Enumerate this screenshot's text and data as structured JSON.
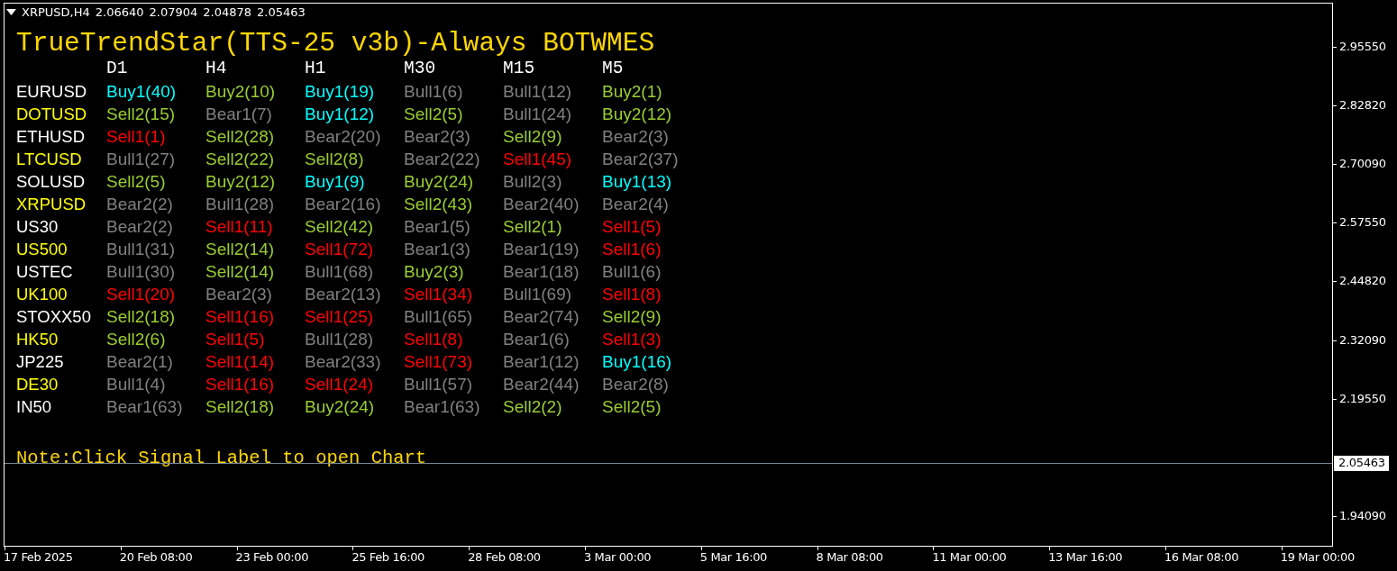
{
  "chart_header": {
    "symbol": "XRPUSD,H4",
    "prices": [
      "2.06640",
      "2.07904",
      "2.04878",
      "2.05463"
    ]
  },
  "panel": {
    "title": "TrueTrendStar(TTS-25 v3b)-Always BOTWMES",
    "columns": [
      "D1",
      "H4",
      "H1",
      "M30",
      "M15",
      "M5"
    ],
    "rows": [
      {
        "symbol": "EURUSD",
        "color": "#ffffff",
        "signals": [
          {
            "text": "Buy1(40)",
            "color": "#00ffff"
          },
          {
            "text": "Buy2(10)",
            "color": "#9acd32"
          },
          {
            "text": "Buy1(19)",
            "color": "#00ffff"
          },
          {
            "text": "Bull1(6)",
            "color": "#808080"
          },
          {
            "text": "Bull1(12)",
            "color": "#808080"
          },
          {
            "text": "Buy2(1)",
            "color": "#9acd32"
          }
        ]
      },
      {
        "symbol": "DOTUSD",
        "color": "#ffff00",
        "signals": [
          {
            "text": "Sell2(15)",
            "color": "#9acd32"
          },
          {
            "text": "Bear1(7)",
            "color": "#808080"
          },
          {
            "text": "Buy1(12)",
            "color": "#00ffff"
          },
          {
            "text": "Sell2(5)",
            "color": "#9acd32"
          },
          {
            "text": "Bull1(24)",
            "color": "#808080"
          },
          {
            "text": "Buy2(12)",
            "color": "#9acd32"
          }
        ]
      },
      {
        "symbol": "ETHUSD",
        "color": "#ffffff",
        "signals": [
          {
            "text": "Sell1(1)",
            "color": "#ff0000"
          },
          {
            "text": "Sell2(28)",
            "color": "#9acd32"
          },
          {
            "text": "Bear2(20)",
            "color": "#808080"
          },
          {
            "text": "Bear2(3)",
            "color": "#808080"
          },
          {
            "text": "Sell2(9)",
            "color": "#9acd32"
          },
          {
            "text": "Bear2(3)",
            "color": "#808080"
          }
        ]
      },
      {
        "symbol": "LTCUSD",
        "color": "#ffff00",
        "signals": [
          {
            "text": "Bull1(27)",
            "color": "#808080"
          },
          {
            "text": "Sell2(22)",
            "color": "#9acd32"
          },
          {
            "text": "Sell2(8)",
            "color": "#9acd32"
          },
          {
            "text": "Bear2(22)",
            "color": "#808080"
          },
          {
            "text": "Sell1(45)",
            "color": "#ff0000"
          },
          {
            "text": "Bear2(37)",
            "color": "#808080"
          }
        ]
      },
      {
        "symbol": "SOLUSD",
        "color": "#ffffff",
        "signals": [
          {
            "text": "Sell2(5)",
            "color": "#9acd32"
          },
          {
            "text": "Buy2(12)",
            "color": "#9acd32"
          },
          {
            "text": "Buy1(9)",
            "color": "#00ffff"
          },
          {
            "text": "Buy2(24)",
            "color": "#9acd32"
          },
          {
            "text": "Bull2(3)",
            "color": "#808080"
          },
          {
            "text": "Buy1(13)",
            "color": "#00ffff"
          }
        ]
      },
      {
        "symbol": "XRPUSD",
        "color": "#ffff00",
        "signals": [
          {
            "text": "Bear2(2)",
            "color": "#808080"
          },
          {
            "text": "Bull1(28)",
            "color": "#808080"
          },
          {
            "text": "Bear2(16)",
            "color": "#808080"
          },
          {
            "text": "Sell2(43)",
            "color": "#9acd32"
          },
          {
            "text": "Bear2(40)",
            "color": "#808080"
          },
          {
            "text": "Bear2(4)",
            "color": "#808080"
          }
        ]
      },
      {
        "symbol": "US30",
        "color": "#ffffff",
        "signals": [
          {
            "text": "Bear2(2)",
            "color": "#808080"
          },
          {
            "text": "Sell1(11)",
            "color": "#ff0000"
          },
          {
            "text": "Sell2(42)",
            "color": "#9acd32"
          },
          {
            "text": "Bear1(5)",
            "color": "#808080"
          },
          {
            "text": "Sell2(1)",
            "color": "#9acd32"
          },
          {
            "text": "Sell1(5)",
            "color": "#ff0000"
          }
        ]
      },
      {
        "symbol": "US500",
        "color": "#ffff00",
        "signals": [
          {
            "text": "Bull1(31)",
            "color": "#808080"
          },
          {
            "text": "Sell2(14)",
            "color": "#9acd32"
          },
          {
            "text": "Sell1(72)",
            "color": "#ff0000"
          },
          {
            "text": "Bear1(3)",
            "color": "#808080"
          },
          {
            "text": "Bear1(19)",
            "color": "#808080"
          },
          {
            "text": "Sell1(6)",
            "color": "#ff0000"
          }
        ]
      },
      {
        "symbol": "USTEC",
        "color": "#ffffff",
        "signals": [
          {
            "text": "Bull1(30)",
            "color": "#808080"
          },
          {
            "text": "Sell2(14)",
            "color": "#9acd32"
          },
          {
            "text": "Bull1(68)",
            "color": "#808080"
          },
          {
            "text": "Buy2(3)",
            "color": "#9acd32"
          },
          {
            "text": "Bear1(18)",
            "color": "#808080"
          },
          {
            "text": "Bull1(6)",
            "color": "#808080"
          }
        ]
      },
      {
        "symbol": "UK100",
        "color": "#ffff00",
        "signals": [
          {
            "text": "Sell1(20)",
            "color": "#ff0000"
          },
          {
            "text": "Bear2(3)",
            "color": "#808080"
          },
          {
            "text": "Bear2(13)",
            "color": "#808080"
          },
          {
            "text": "Sell1(34)",
            "color": "#ff0000"
          },
          {
            "text": "Bull1(69)",
            "color": "#808080"
          },
          {
            "text": "Sell1(8)",
            "color": "#ff0000"
          }
        ]
      },
      {
        "symbol": "STOXX50",
        "color": "#ffffff",
        "signals": [
          {
            "text": "Sell2(18)",
            "color": "#9acd32"
          },
          {
            "text": "Sell1(16)",
            "color": "#ff0000"
          },
          {
            "text": "Sell1(25)",
            "color": "#ff0000"
          },
          {
            "text": "Bull1(65)",
            "color": "#808080"
          },
          {
            "text": "Bear2(74)",
            "color": "#808080"
          },
          {
            "text": "Sell2(9)",
            "color": "#9acd32"
          }
        ]
      },
      {
        "symbol": "HK50",
        "color": "#ffff00",
        "signals": [
          {
            "text": "Sell2(6)",
            "color": "#9acd32"
          },
          {
            "text": "Sell1(5)",
            "color": "#ff0000"
          },
          {
            "text": "Bull1(28)",
            "color": "#808080"
          },
          {
            "text": "Sell1(8)",
            "color": "#ff0000"
          },
          {
            "text": "Bear1(6)",
            "color": "#808080"
          },
          {
            "text": "Sell1(3)",
            "color": "#ff0000"
          }
        ]
      },
      {
        "symbol": "JP225",
        "color": "#ffffff",
        "signals": [
          {
            "text": "Bear2(1)",
            "color": "#808080"
          },
          {
            "text": "Sell1(14)",
            "color": "#ff0000"
          },
          {
            "text": "Bear2(33)",
            "color": "#808080"
          },
          {
            "text": "Sell1(73)",
            "color": "#ff0000"
          },
          {
            "text": "Bear1(12)",
            "color": "#808080"
          },
          {
            "text": "Buy1(16)",
            "color": "#00ffff"
          }
        ]
      },
      {
        "symbol": "DE30",
        "color": "#ffff00",
        "signals": [
          {
            "text": "Bull1(4)",
            "color": "#808080"
          },
          {
            "text": "Sell1(16)",
            "color": "#ff0000"
          },
          {
            "text": "Sell1(24)",
            "color": "#ff0000"
          },
          {
            "text": "Bull1(57)",
            "color": "#808080"
          },
          {
            "text": "Bear2(44)",
            "color": "#808080"
          },
          {
            "text": "Bear2(8)",
            "color": "#808080"
          }
        ]
      },
      {
        "symbol": "IN50",
        "color": "#ffffff",
        "signals": [
          {
            "text": "Bear1(63)",
            "color": "#808080"
          },
          {
            "text": "Sell2(18)",
            "color": "#9acd32"
          },
          {
            "text": "Buy2(24)",
            "color": "#9acd32"
          },
          {
            "text": "Bear1(63)",
            "color": "#808080"
          },
          {
            "text": "Sell2(2)",
            "color": "#9acd32"
          },
          {
            "text": "Sell2(5)",
            "color": "#9acd32"
          }
        ]
      }
    ],
    "note": "Note:Click Signal Label to open Chart"
  },
  "price_axis": {
    "labels": [
      "2.95550",
      "2.82820",
      "2.70090",
      "2.57550",
      "2.44820",
      "2.32090",
      "2.19550",
      "1.94090"
    ],
    "current_price": "2.05463"
  },
  "time_axis": {
    "labels": [
      "17 Feb 2025",
      "20 Feb 08:00",
      "23 Feb 00:00",
      "25 Feb 16:00",
      "28 Feb 08:00",
      "3 Mar 00:00",
      "5 Mar 16:00",
      "8 Mar 08:00",
      "11 Mar 00:00",
      "13 Mar 16:00",
      "16 Mar 08:00",
      "19 Mar 00:00"
    ]
  }
}
